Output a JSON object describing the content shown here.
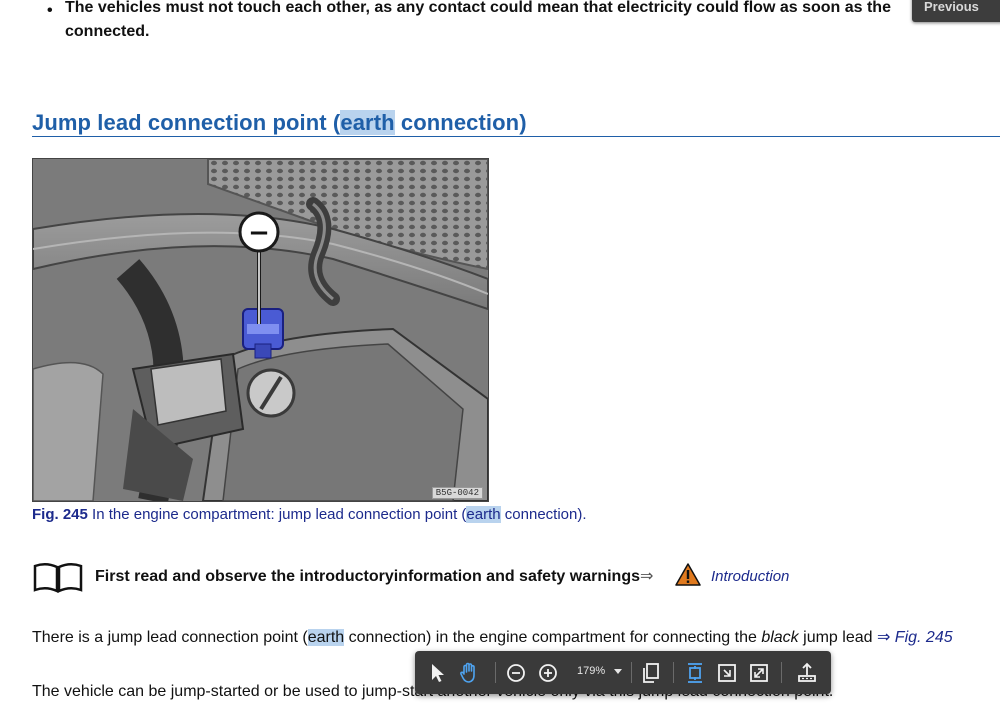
{
  "bullet_text": "The vehicles must not touch each other, as any contact could mean that electricity could flow as soon as the poles are connected.",
  "bullet_line1": "The vehicles must not touch each other, as any contact could mean that electricity could flow as soon as the",
  "bullet_line2": "connected.",
  "previous_button": "Previous",
  "heading": {
    "before": "Jump lead connection point (",
    "highlight": "earth",
    "after": " connection)"
  },
  "figure": {
    "code": "B5G-0042",
    "symbol": "−"
  },
  "caption": {
    "label": "Fig. 245",
    "before": " In the engine compartment: jump lead connection point (",
    "highlight": "earth",
    "after": " connection)."
  },
  "note": {
    "text": "First read and observe the introductoryinformation and safety warnings",
    "arrow": "⇒",
    "link": "Introduction"
  },
  "para1": {
    "p1": "There is a jump lead connection point (",
    "highlight": "earth",
    "p2": " connection) in the engine compartment for connecting the ",
    "italic": "black",
    "p3": " jump lead ",
    "ref": "⇒ Fig. 245"
  },
  "para2": "The vehicle can be jump-started or be used to jump-start another vehicle only via this jump lead connection point.",
  "toolbar": {
    "zoom": "179%"
  },
  "colors": {
    "heading": "#1f5fa8",
    "link": "#1c2a8c",
    "highlight": "#b9d3ee",
    "toolbar": "#3a3a3a",
    "toolbar_active": "#4ea3f0",
    "warning": "#e07a1f"
  }
}
